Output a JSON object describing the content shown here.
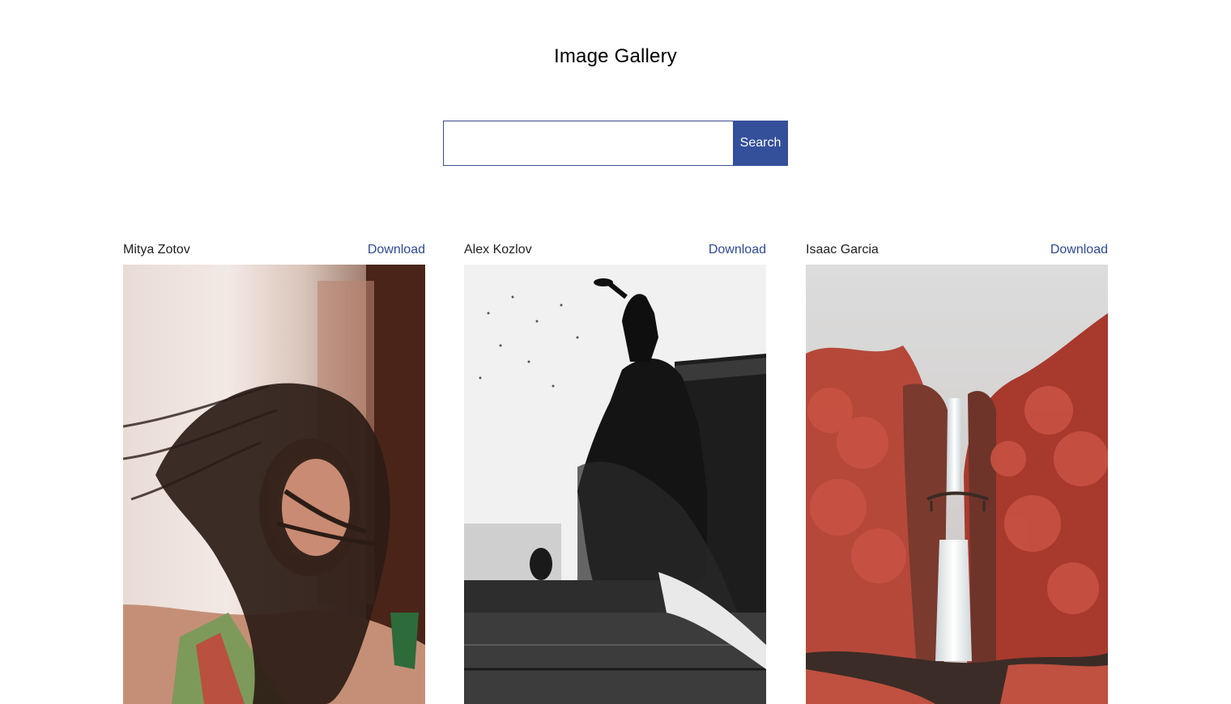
{
  "page": {
    "title": "Image Gallery"
  },
  "search": {
    "value": "",
    "placeholder": "",
    "button_label": "Search"
  },
  "colors": {
    "accent": "#35509a",
    "link": "#2f4a94"
  },
  "gallery": [
    {
      "author": "Mitya Zotov",
      "download_label": "Download",
      "image": "woman-windblown-hair-photo"
    },
    {
      "author": "Alex Kozlov",
      "download_label": "Download",
      "image": "fountain-statue-bw-photo"
    },
    {
      "author": "Isaac Garcia",
      "download_label": "Download",
      "image": "red-forest-waterfall-photo"
    }
  ]
}
